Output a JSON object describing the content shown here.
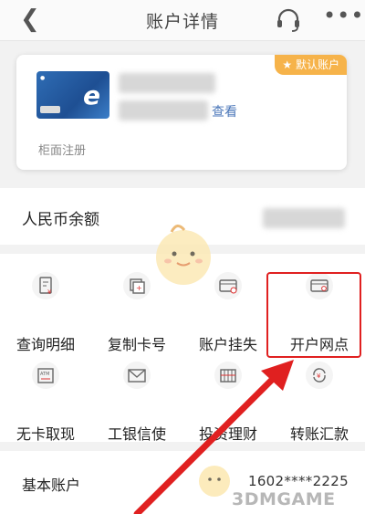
{
  "header": {
    "title": "账户详情",
    "back_icon": "chevron-left-icon",
    "support_icon": "headset-icon",
    "more_icon": "more-dots-icon"
  },
  "card": {
    "badge": "★ 默认账户",
    "view_link": "查看",
    "note": "柜面注册"
  },
  "balance": {
    "label": "人民币余额"
  },
  "actions": [
    {
      "label": "查询明细",
      "icon": "statement-icon"
    },
    {
      "label": "复制卡号",
      "icon": "copy-icon"
    },
    {
      "label": "账户挂失",
      "icon": "card-lock-icon"
    },
    {
      "label": "开户网点",
      "icon": "branch-card-icon"
    },
    {
      "label": "无卡取现",
      "icon": "atm-icon"
    },
    {
      "label": "工银信使",
      "icon": "mail-icon"
    },
    {
      "label": "投资理财",
      "icon": "invest-icon"
    },
    {
      "label": "转账汇款",
      "icon": "transfer-icon"
    }
  ],
  "basic_account": {
    "label": "基本账户",
    "number": "1602****2225"
  },
  "watermark": "3DMGAME",
  "colors": {
    "accent": "#e02020",
    "badge": "#f6b34a",
    "link": "#4a76b8"
  }
}
